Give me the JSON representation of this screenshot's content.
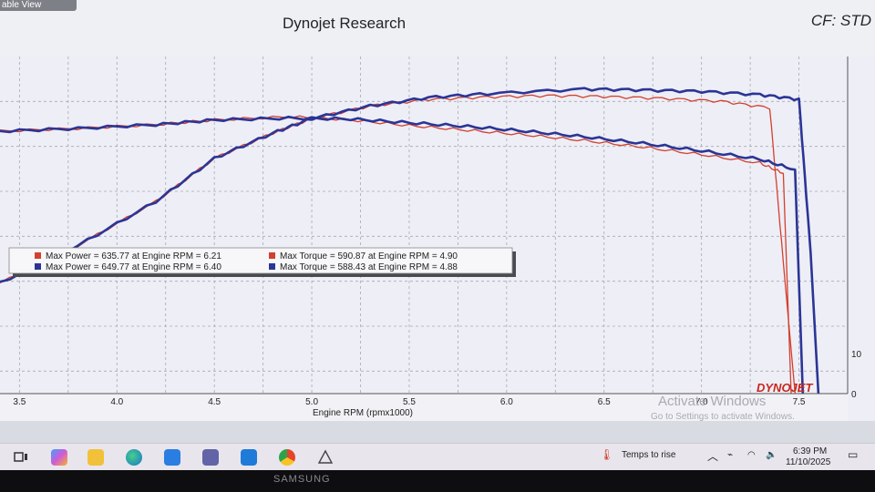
{
  "window": {
    "tab_label": "able View",
    "title": "Dynojet Research",
    "cf_label": "CF: STD"
  },
  "chart_data": {
    "type": "line",
    "xlabel": "Engine RPM (rpmx1000)",
    "x_ticks": [
      "3.5",
      "4.0",
      "4.5",
      "5.0",
      "5.5",
      "6.0",
      "6.5",
      "7.0",
      "7.5"
    ],
    "xlim": [
      3.4,
      7.75
    ],
    "right_axis_ticks": [
      "0",
      "10"
    ],
    "grid": true,
    "logo": "DYNOJET",
    "legend": [
      {
        "color": "#d2402e",
        "text": "Max Power = 635.77 at Engine RPM = 6.21"
      },
      {
        "color": "#d2402e",
        "text": "Max Torque = 590.87 at Engine RPM = 4.90"
      },
      {
        "color": "#2b3596",
        "text": "Max Power = 649.77 at Engine RPM = 6.40"
      },
      {
        "color": "#2b3596",
        "text": "Max Torque = 588.43 at Engine RPM = 4.88"
      }
    ],
    "series": [
      {
        "color": "#d2402e",
        "kind": "power",
        "x": [
          3.4,
          3.8,
          4.2,
          4.5,
          4.8,
          5.0,
          5.3,
          5.6,
          5.9,
          6.21,
          6.5,
          6.8,
          7.1,
          7.35,
          7.42,
          7.48
        ],
        "y": [
          236,
          316,
          410,
          502,
          556,
          587,
          614,
          628,
          633,
          636,
          634,
          630,
          624,
          610,
          280,
          0
        ]
      },
      {
        "color": "#d2402e",
        "kind": "torque",
        "x": [
          3.4,
          3.8,
          4.2,
          4.5,
          4.9,
          5.2,
          5.5,
          5.8,
          6.1,
          6.4,
          6.7,
          7.0,
          7.3,
          7.42,
          7.46
        ],
        "y": [
          560,
          566,
          574,
          584,
          591,
          584,
          572,
          562,
          552,
          540,
          526,
          510,
          492,
          470,
          0
        ]
      },
      {
        "color": "#2b3596",
        "kind": "power",
        "x": [
          3.4,
          3.8,
          4.2,
          4.5,
          4.8,
          5.0,
          5.3,
          5.6,
          5.9,
          6.4,
          6.7,
          7.0,
          7.3,
          7.5,
          7.56,
          7.6
        ],
        "y": [
          236,
          316,
          410,
          502,
          556,
          587,
          614,
          632,
          640,
          650,
          648,
          645,
          638,
          628,
          300,
          0
        ]
      },
      {
        "color": "#2b3596",
        "kind": "torque",
        "x": [
          3.4,
          3.8,
          4.2,
          4.5,
          4.88,
          5.2,
          5.5,
          5.8,
          6.1,
          6.4,
          6.7,
          7.0,
          7.3,
          7.48,
          7.52
        ],
        "y": [
          560,
          566,
          574,
          584,
          588,
          586,
          578,
          570,
          560,
          548,
          534,
          518,
          500,
          478,
          0
        ]
      }
    ]
  },
  "activate": {
    "line1": "Activate Windows",
    "line2": "Go to Settings to activate Windows."
  },
  "taskbar": {
    "weather": "Temps to rise",
    "time": "6:39 PM",
    "date": "11/10/2025"
  },
  "bezel": {
    "brand": "SAMSUNG"
  },
  "icons": [
    "task-view-icon",
    "copilot-icon",
    "file-explorer-icon",
    "edge-icon",
    "store-icon",
    "teams-icon",
    "outlook-icon",
    "chrome-icon",
    "dynojet-app-icon"
  ]
}
